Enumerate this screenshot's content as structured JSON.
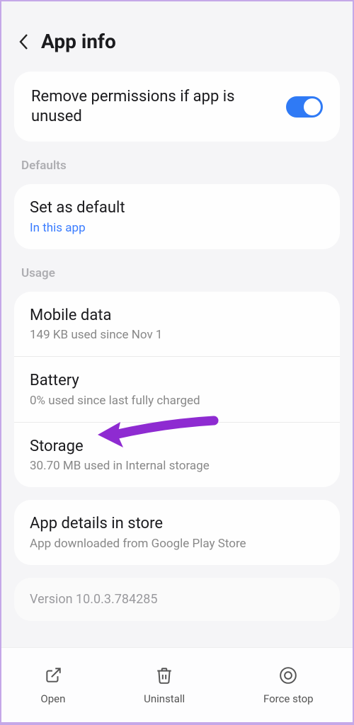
{
  "header": {
    "title": "App info"
  },
  "permissions_card": {
    "toggle_label": "Remove permissions if app is unused",
    "toggle_on": true
  },
  "defaults": {
    "section": "Defaults",
    "set_default": "Set as default",
    "sub": "In this app"
  },
  "usage": {
    "section": "Usage",
    "mobile": {
      "title": "Mobile data",
      "sub": "149 KB used since Nov 1"
    },
    "battery": {
      "title": "Battery",
      "sub": "0% used since last fully charged"
    },
    "storage": {
      "title": "Storage",
      "sub": "30.70 MB used in Internal storage"
    }
  },
  "store": {
    "title": "App details in store",
    "sub": "App downloaded from Google Play Store"
  },
  "version": {
    "text": "Version 10.0.3.784285"
  },
  "nav": {
    "open": "Open",
    "uninstall": "Uninstall",
    "force_stop": "Force stop"
  },
  "colors": {
    "accent": "#2f7af5",
    "link": "#3a7cff",
    "annotation": "#8e2bd1"
  }
}
